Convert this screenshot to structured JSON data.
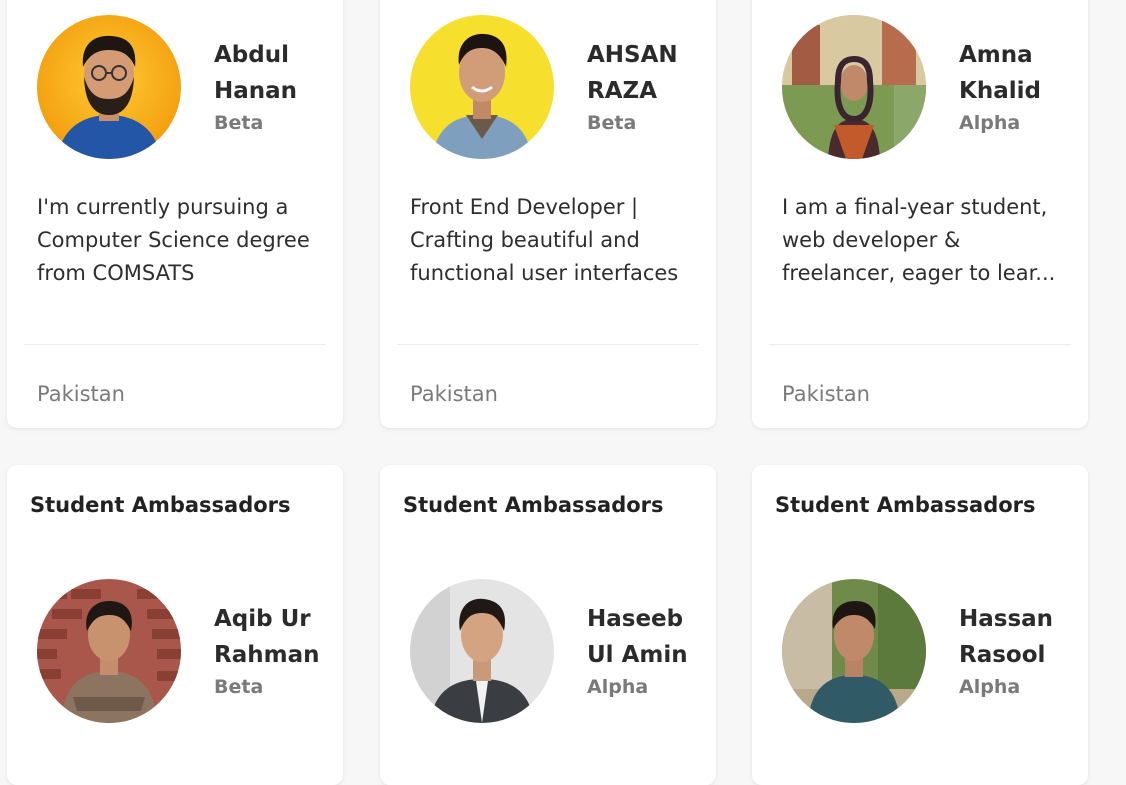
{
  "profiles": [
    {
      "first": "Abdul",
      "last": "Hanan",
      "level": "Beta",
      "bio": "I'm currently pursuing a Computer Science degree from COMSATS",
      "country": "Pakistan"
    },
    {
      "first": "AHSAN",
      "last": "RAZA",
      "level": "Beta",
      "bio": "Front End Developer | Crafting beautiful and functional user interfaces",
      "country": "Pakistan"
    },
    {
      "first": "Amna",
      "last": "Khalid",
      "level": "Alpha",
      "bio": "I am a final-year student, web developer & freelancer, eager to lear...",
      "country": "Pakistan"
    }
  ],
  "ambassadors": [
    {
      "heading": "Student Ambassadors",
      "first": "Aqib Ur",
      "last": "Rahman",
      "level": "Beta"
    },
    {
      "heading": "Student Ambassadors",
      "first": "Haseeb",
      "last": "Ul Amin",
      "level": "Alpha"
    },
    {
      "heading": "Student Ambassadors",
      "first": "Hassan",
      "last": "Rasool",
      "level": "Alpha"
    }
  ],
  "colors": {
    "avatar_bg_1": "#f5a516",
    "avatar_bg_2": "#f7df2e",
    "avatar_bg_3": "#c9b38a",
    "avatar_bg_4": "#a8574a",
    "avatar_bg_5": "#e4e4e4",
    "avatar_bg_6": "#6f8a4a"
  }
}
